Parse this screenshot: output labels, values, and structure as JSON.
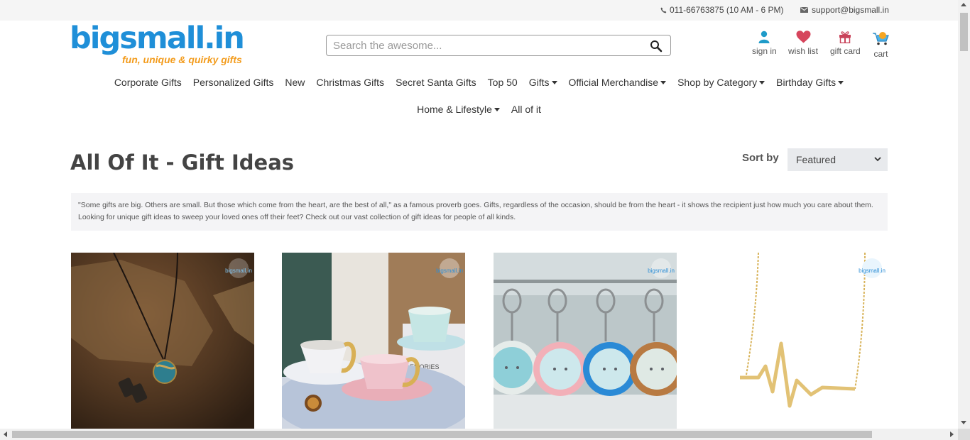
{
  "topbar": {
    "phone": "011-66763875 (10 AM - 6 PM)",
    "email": "support@bigsmall.in"
  },
  "logo": {
    "name": "bigsmall.in",
    "tagline": "fun, unique & quirky gifts"
  },
  "search": {
    "placeholder": "Search the awesome..."
  },
  "header_links": {
    "sign_in": "sign in",
    "wish_list": "wish list",
    "gift_card": "gift card",
    "cart": "cart"
  },
  "nav": {
    "row1": [
      {
        "label": "Corporate Gifts",
        "dropdown": false
      },
      {
        "label": "Personalized Gifts",
        "dropdown": false
      },
      {
        "label": "New",
        "dropdown": false
      },
      {
        "label": "Christmas Gifts",
        "dropdown": false
      },
      {
        "label": "Secret Santa Gifts",
        "dropdown": false
      },
      {
        "label": "Top 50",
        "dropdown": false
      },
      {
        "label": "Gifts",
        "dropdown": true
      },
      {
        "label": "Official Merchandise",
        "dropdown": true
      },
      {
        "label": "Shop by Category",
        "dropdown": true
      },
      {
        "label": "Birthday Gifts",
        "dropdown": true
      }
    ],
    "row2": [
      {
        "label": "Home & Lifestyle",
        "dropdown": true
      },
      {
        "label": "All of it",
        "dropdown": false
      }
    ]
  },
  "page": {
    "title": "All Of It - Gift Ideas",
    "sort_label": "Sort by",
    "sort_value": "Featured",
    "description": "\"Some gifts are big. Others are small. But those which come from the heart, are the best of all,\" as a famous proverb goes. Gifts, regardless of the occasion, should be from the heart - it shows the recipient just how much you care about them. Looking for unique gift ideas to sweep your loved ones off their feet? Check out our vast collection of gift ideas for people of all kinds.",
    "watermark": "bigsmall.in",
    "product_text": "EMORIES"
  },
  "colors": {
    "brand_blue": "#1f8fd8",
    "brand_orange": "#f39c1d",
    "heart": "#d6455c",
    "desc_bg": "#f4f4f6"
  },
  "icons": {
    "phone": "phone-icon",
    "mail": "mail-icon",
    "search": "search-icon",
    "sign_in": "user-icon",
    "wish_list": "heart-icon",
    "gift_card": "gift-icon",
    "cart": "cart-icon"
  }
}
